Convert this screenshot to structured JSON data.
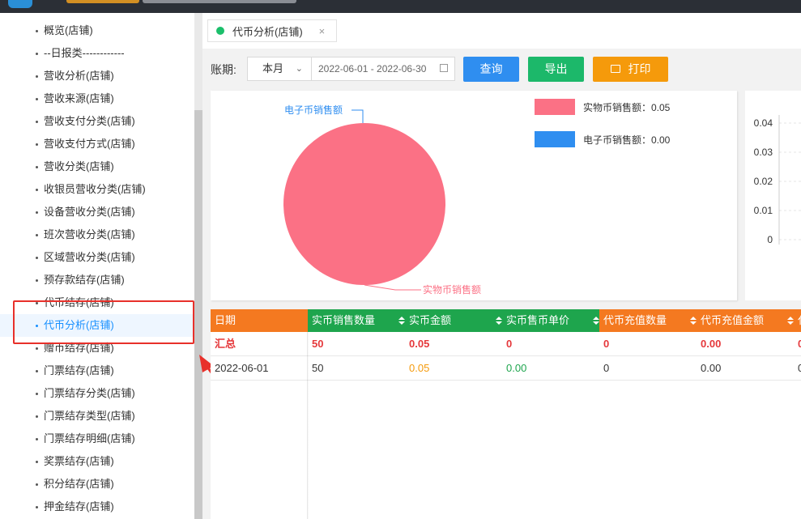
{
  "sidebar": {
    "items": [
      {
        "label": "概览(店铺)"
      },
      {
        "label": "--日报类------------"
      },
      {
        "label": "营收分析(店铺)"
      },
      {
        "label": "营收来源(店铺)"
      },
      {
        "label": "营收支付分类(店铺)"
      },
      {
        "label": "营收支付方式(店铺)"
      },
      {
        "label": "营收分类(店铺)"
      },
      {
        "label": "收银员营收分类(店铺)"
      },
      {
        "label": "设备营收分类(店铺)"
      },
      {
        "label": "班次营收分类(店铺)"
      },
      {
        "label": "区域营收分类(店铺)"
      },
      {
        "label": "预存款结存(店铺)"
      },
      {
        "label": "代币结存(店铺)"
      },
      {
        "label": "代币分析(店铺)",
        "active": true
      },
      {
        "label": "赠币结存(店铺)"
      },
      {
        "label": "门票结存(店铺)"
      },
      {
        "label": "门票结存分类(店铺)"
      },
      {
        "label": "门票结存类型(店铺)"
      },
      {
        "label": "门票结存明细(店铺)"
      },
      {
        "label": "奖票结存(店铺)"
      },
      {
        "label": "积分结存(店铺)"
      },
      {
        "label": "押金结存(店铺)"
      }
    ]
  },
  "tabs": [
    {
      "label": "代币分析(店铺)",
      "close_icon": "×"
    }
  ],
  "filter": {
    "period_label": "账期:",
    "period_value": "本月",
    "date_range": "2022-06-01 - 2022-06-30",
    "query_label": "查询",
    "export_label": "导出",
    "print_label": "打印"
  },
  "chart_data": [
    {
      "type": "pie",
      "categories": [
        "实物币销售额",
        "电子币销售额"
      ],
      "values": [
        0.05,
        0.0
      ],
      "colors": [
        "#fb7185",
        "#2f8ef0"
      ],
      "legend": [
        "实物币销售额：0.05",
        "电子币销售额：0.00"
      ],
      "slice_labels": [
        "实物币销售额",
        "电子币销售额"
      ],
      "legend_position": "top-right"
    },
    {
      "type": "bar",
      "yticks": [
        "0.04",
        "0.03",
        "0.02",
        "0.01",
        "0"
      ],
      "ylim": [
        0,
        0.04
      ]
    }
  ],
  "table": {
    "columns": [
      {
        "label": "日期",
        "color": "#f47920"
      },
      {
        "label": "实币销售数量",
        "color": "#1ea54d"
      },
      {
        "label": "实币金额",
        "color": "#1ea54d"
      },
      {
        "label": "实币售币单价",
        "color": "#1ea54d"
      },
      {
        "label": "代币充值数量",
        "color": "#f47920"
      },
      {
        "label": "代币充值金额",
        "color": "#f47920"
      },
      {
        "label": "代",
        "color": "#f47920"
      }
    ],
    "summary": [
      "汇总",
      "50",
      "0.05",
      "0",
      "0",
      "0.00",
      "0"
    ],
    "rows": [
      [
        "2022-06-01",
        "50",
        "0.05",
        "0.00",
        "0",
        "0.00",
        "0"
      ]
    ]
  },
  "colors": {
    "accent": "#1890ff",
    "highlight": "#e8302a",
    "orange_value": "#f59a0b",
    "green_value": "#1ea54d"
  }
}
